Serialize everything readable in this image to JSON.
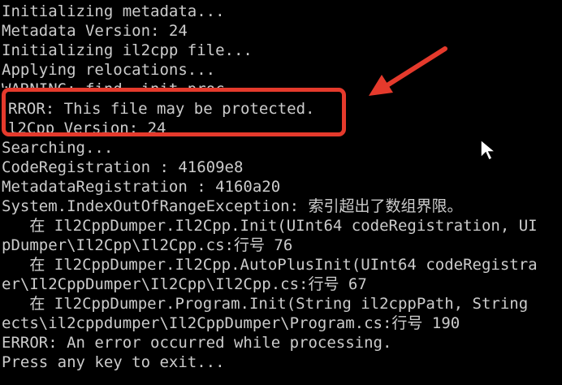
{
  "console": {
    "lines": [
      "Initializing metadata...",
      "Metadata Version: 24",
      "Initializing il2cpp file...",
      "Applying relocations...",
      "WARNING: find .init_proc",
      "RROR: This file may be protected.",
      "l2Cpp Version: 24",
      "Searching...",
      "CodeRegistration : 41609e8",
      "MetadataRegistration : 4160a20",
      "System.IndexOutOfRangeException: 索引超出了数组界限。",
      "   在 Il2CppDumper.Il2Cpp.Init(UInt64 codeRegistration, UI",
      "pDumper\\Il2Cpp\\Il2Cpp.cs:行号 76",
      "   在 Il2CppDumper.Il2Cpp.AutoPlusInit(UInt64 codeRegistra",
      "er\\Il2CppDumper\\Il2Cpp\\Il2Cpp.cs:行号 67",
      "   在 Il2CppDumper.Program.Init(String il2cppPath, String",
      "ects\\il2cppdumper\\Il2CppDumper\\Program.cs:行号 190",
      "ERROR: An error occurred while processing.",
      "Press any key to exit..."
    ]
  },
  "annotation": {
    "box_color": "#e53a2c",
    "arrow_color": "#e53a2c"
  },
  "cursor": {
    "icon": "mouse-pointer-icon"
  }
}
